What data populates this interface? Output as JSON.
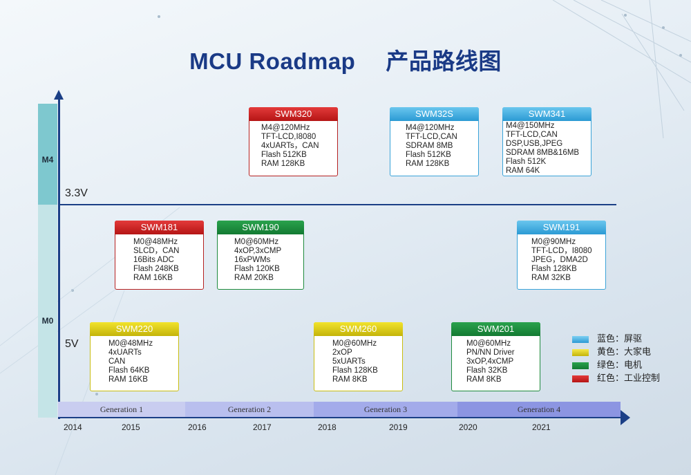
{
  "title": {
    "en": "MCU Roadmap",
    "cn": "产品路线图"
  },
  "bands": {
    "m4": "M4",
    "m0": "M0"
  },
  "voltages": {
    "v33": "3.3V",
    "v5": "5V"
  },
  "generations": [
    "Generation 1",
    "Generation 2",
    "Generation 3",
    "Generation 4"
  ],
  "years": [
    "2014",
    "2015",
    "2016",
    "2017",
    "2018",
    "2019",
    "2020",
    "2021"
  ],
  "products": {
    "swm320": {
      "name": "SWM320",
      "lines": [
        "M4@120MHz",
        "TFT-LCD,I8080",
        "4xUARTs，CAN",
        "Flash 512KB",
        "RAM 128KB"
      ]
    },
    "swm32s": {
      "name": "SWM32S",
      "lines": [
        "M4@120MHz",
        "TFT-LCD,CAN",
        "SDRAM 8MB",
        "Flash 512KB",
        "RAM 128KB"
      ]
    },
    "swm341": {
      "name": "SWM341",
      "lines": [
        "M4@150MHz",
        "TFT-LCD,CAN",
        "DSP,USB,JPEG",
        "SDRAM 8MB&16MB",
        "Flash 512K",
        "RAM 64K"
      ]
    },
    "swm181": {
      "name": "SWM181",
      "lines": [
        "M0@48MHz",
        "SLCD，CAN",
        "16Bits ADC",
        "Flash 248KB",
        "RAM 16KB"
      ]
    },
    "swm190": {
      "name": "SWM190",
      "lines": [
        "M0@60MHz",
        "4xOP,3xCMP",
        "16xPWMs",
        "Flash 120KB",
        "RAM 20KB"
      ]
    },
    "swm191": {
      "name": "SWM191",
      "lines": [
        "M0@90MHz",
        "TFT-LCD，I8080",
        "JPEG，DMA2D",
        "Flash 128KB",
        "RAM 32KB"
      ]
    },
    "swm220": {
      "name": "SWM220",
      "lines": [
        "M0@48MHz",
        "4xUARTs",
        "CAN",
        "Flash 64KB",
        "RAM 16KB"
      ]
    },
    "swm260": {
      "name": "SWM260",
      "lines": [
        "M0@60MHz",
        "2xOP",
        "5xUARTs",
        "Flash 128KB",
        "RAM 8KB"
      ]
    },
    "swm201": {
      "name": "SWM201",
      "lines": [
        "M0@60MHz",
        "PN/NN Driver",
        "3xOP,4xCMP",
        "Flash 32KB",
        "RAM 8KB"
      ]
    }
  },
  "legend": [
    {
      "label": "蓝色：屏驱",
      "color": "#3aa3d8"
    },
    {
      "label": "黄色：大家电",
      "color": "#e6d51a"
    },
    {
      "label": "绿色：电机",
      "color": "#1d8a3c"
    },
    {
      "label": "红色：工业控制",
      "color": "#c42020"
    }
  ]
}
